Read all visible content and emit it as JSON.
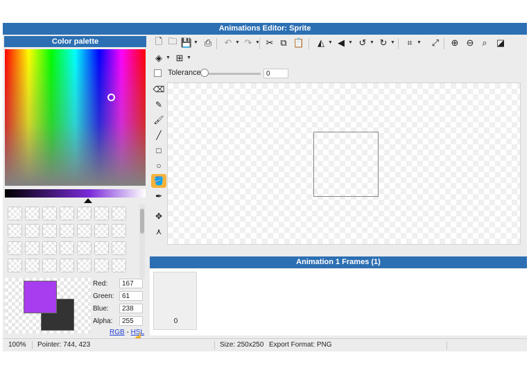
{
  "window": {
    "title": "Animations Editor: Sprite"
  },
  "palette": {
    "title": "Color palette",
    "current": {
      "red": "167",
      "green": "61",
      "blue": "238",
      "alpha": "255"
    },
    "labels": {
      "red": "Red:",
      "green": "Green:",
      "blue": "Blue:",
      "alpha": "Alpha:"
    },
    "fg_color": "#a73dee",
    "bg_color": "#333333",
    "links": {
      "rgb": "RGB",
      "sep": "-",
      "hsl": "HSL"
    }
  },
  "toolbar": {
    "row1_icons": [
      "new-file-icon",
      "open-folder-icon",
      "save-icon",
      "export-icon",
      "undo-icon",
      "redo-icon",
      "cut-icon",
      "copy-icon",
      "paste-icon",
      "flip-horizontal-icon",
      "flip-vertical-icon",
      "rotate-left-icon",
      "rotate-right-icon",
      "crop-icon",
      "resize-icon",
      "zoom-in-icon",
      "zoom-out-icon",
      "zoom-reset-icon",
      "invert-icon"
    ],
    "row2_icons": [
      "layers-icon",
      "grid-icon"
    ]
  },
  "tolerance": {
    "label": "Tolerance",
    "value": "0",
    "slider_fraction": 0
  },
  "tools": [
    "eraser-icon",
    "pencil-icon",
    "brush-icon",
    "line-icon",
    "rectangle-icon",
    "ellipse-icon",
    "fill-bucket-icon",
    "eyedropper-icon",
    "move-point-icon",
    "node-icon"
  ],
  "active_tool": "fill-bucket-icon",
  "frames": {
    "title": "Animation 1 Frames (1)",
    "items": [
      {
        "label": "0"
      }
    ]
  },
  "status": {
    "zoom": "100%",
    "pointer": "Pointer: 744, 423",
    "size": "Size: 250x250",
    "export": "Export Format: PNG"
  }
}
